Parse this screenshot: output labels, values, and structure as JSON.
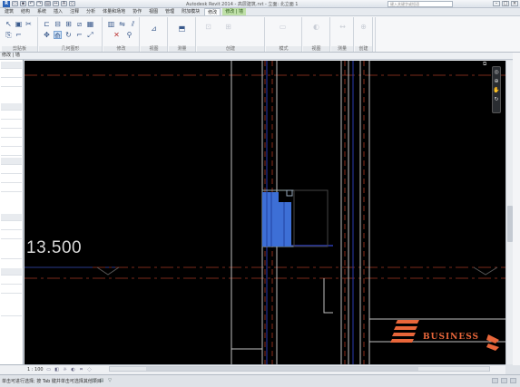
{
  "titlebar": {
    "title": "Autodesk Revit 2014 -   高层建筑.rvt - 立面: 北立面 1",
    "search_placeholder": "键入关键字或短语",
    "logo": "R"
  },
  "tabs": [
    "建筑",
    "结构",
    "系统",
    "插入",
    "注释",
    "分析",
    "体量和场地",
    "协作",
    "视图",
    "管理",
    "附加模块",
    "修改",
    "修改 | 墙"
  ],
  "active_tab_index": 11,
  "ribbon": {
    "groups": [
      "剪贴板",
      "几何图形",
      "修改",
      "视图",
      "测量",
      "创建",
      "模式",
      "视图",
      "测量",
      "创建",
      "模式"
    ]
  },
  "options_bar": {
    "text": "修改 | 墙"
  },
  "properties": {
    "rows": 30
  },
  "viewport": {
    "elevation_label": "13.500",
    "brand_text": "BUSINESS",
    "accent_color": "#e8663a",
    "selection_color": "#3d6fd6"
  },
  "view_control": {
    "scale": "1 : 100"
  },
  "statusbar": {
    "text": "单击可进行选择; 按 Tab 键并单击可选择其他项目"
  },
  "icons": [
    "app-logo-icon",
    "search-icon",
    "navigation-wheel-icon",
    "zoom-icon",
    "pan-icon",
    "orbit-icon"
  ]
}
